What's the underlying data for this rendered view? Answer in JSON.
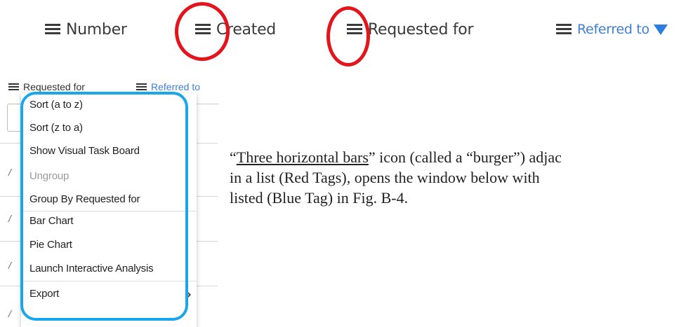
{
  "header": {
    "columns": [
      {
        "label": "Number"
      },
      {
        "label": "Created"
      },
      {
        "label": "Requested for"
      },
      {
        "label": "Referred to"
      }
    ]
  },
  "list": {
    "headers": [
      "Requested for",
      "Referred to"
    ]
  },
  "menu": {
    "items": [
      {
        "label": "Sort (a to z)",
        "disabled": false
      },
      {
        "label": "Sort (z to a)",
        "disabled": false
      },
      {
        "label": "Show Visual Task Board",
        "disabled": false
      },
      {
        "label": "Ungroup",
        "disabled": true
      },
      {
        "label": "Group By Requested for",
        "disabled": false
      },
      {
        "label": "Bar Chart",
        "disabled": false
      },
      {
        "label": "Pie Chart",
        "disabled": false
      },
      {
        "label": "Launch Interactive Analysis",
        "disabled": false
      },
      {
        "label": "Export",
        "disabled": false
      }
    ]
  },
  "caption": {
    "open_quote": "“",
    "link_text": "Three horizontal bars",
    "line1_rest": "” icon (called a “burger”) adjac",
    "line2": "in a list (Red Tags), opens the window below with",
    "line3": "listed (Blue Tag) in Fig. B-4."
  },
  "colors": {
    "red_tag": "#e3141b",
    "blue_tag": "#1aa7ea",
    "link_blue": "#3f7fd4",
    "text": "#3a3a3a"
  },
  "icons": {
    "burger": "burger-icon",
    "sort_down": "filled-triangle-down-icon",
    "submenu": "chevron-right-icon"
  }
}
